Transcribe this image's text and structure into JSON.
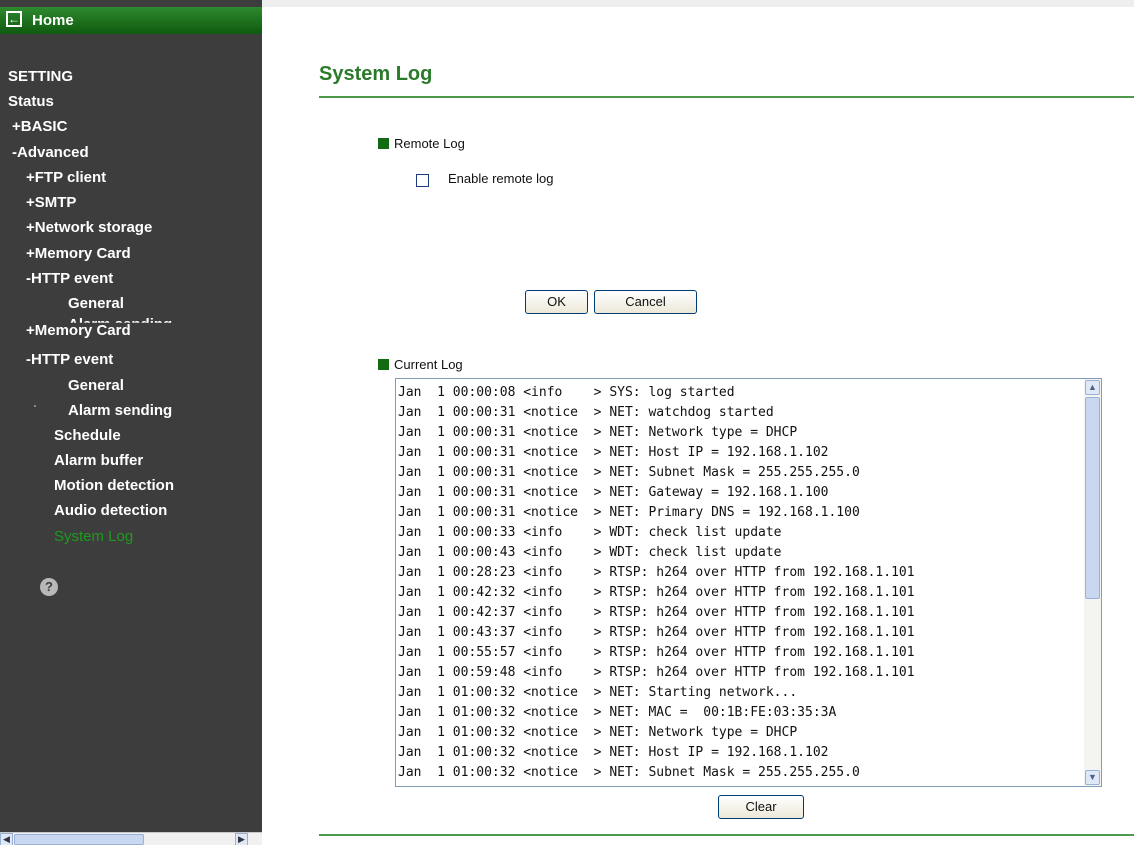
{
  "sidebar": {
    "home_label": "Home",
    "home_icon": "back-arrow-icon",
    "items": [
      {
        "label": "SETTING"
      },
      {
        "label": "Status"
      },
      {
        "label": "+BASIC"
      },
      {
        "label": "-Advanced"
      },
      {
        "label": "+FTP client"
      },
      {
        "label": "+SMTP"
      },
      {
        "label": "+Network storage"
      },
      {
        "label": "+Memory Card"
      },
      {
        "label": "-HTTP event"
      },
      {
        "label": "General"
      },
      {
        "label": "Alarm sending"
      },
      {
        "label": "+Memory Card"
      },
      {
        "label": "-HTTP event"
      },
      {
        "label": "General"
      },
      {
        "label": "Alarm sending"
      },
      {
        "label": "Schedule"
      },
      {
        "label": "Alarm buffer"
      },
      {
        "label": "Motion detection"
      },
      {
        "label": "Audio detection"
      },
      {
        "label": "System Log"
      }
    ],
    "help_glyph": "?",
    "active_color": "#1e9a1e"
  },
  "main": {
    "title": "System Log",
    "remote_log": {
      "heading": "Remote Log",
      "checkbox_label": "Enable remote log",
      "checked": false
    },
    "buttons": {
      "ok": "OK",
      "cancel": "Cancel",
      "clear": "Clear"
    },
    "current_log": {
      "heading": "Current Log",
      "lines": [
        "Jan  1 00:00:08 <info    > SYS: log started",
        "Jan  1 00:00:31 <notice  > NET: watchdog started",
        "Jan  1 00:00:31 <notice  > NET: Network type = DHCP",
        "Jan  1 00:00:31 <notice  > NET: Host IP = 192.168.1.102",
        "Jan  1 00:00:31 <notice  > NET: Subnet Mask = 255.255.255.0",
        "Jan  1 00:00:31 <notice  > NET: Gateway = 192.168.1.100",
        "Jan  1 00:00:31 <notice  > NET: Primary DNS = 192.168.1.100",
        "Jan  1 00:00:33 <info    > WDT: check list update",
        "Jan  1 00:00:43 <info    > WDT: check list update",
        "Jan  1 00:28:23 <info    > RTSP: h264 over HTTP from 192.168.1.101",
        "Jan  1 00:42:32 <info    > RTSP: h264 over HTTP from 192.168.1.101",
        "Jan  1 00:42:37 <info    > RTSP: h264 over HTTP from 192.168.1.101",
        "Jan  1 00:43:37 <info    > RTSP: h264 over HTTP from 192.168.1.101",
        "Jan  1 00:55:57 <info    > RTSP: h264 over HTTP from 192.168.1.101",
        "Jan  1 00:59:48 <info    > RTSP: h264 over HTTP from 192.168.1.101",
        "Jan  1 01:00:32 <notice  > NET: Starting network...",
        "Jan  1 01:00:32 <notice  > NET: MAC =  00:1B:FE:03:35:3A",
        "Jan  1 01:00:32 <notice  > NET: Network type = DHCP",
        "Jan  1 01:00:32 <notice  > NET: Host IP = 192.168.1.102",
        "Jan  1 01:00:32 <notice  > NET: Subnet Mask = 255.255.255.0"
      ]
    }
  },
  "colors": {
    "sidebar_bg": "#3d3d3d",
    "title_green": "#2a7a2a",
    "bullet_green": "#126b12"
  }
}
